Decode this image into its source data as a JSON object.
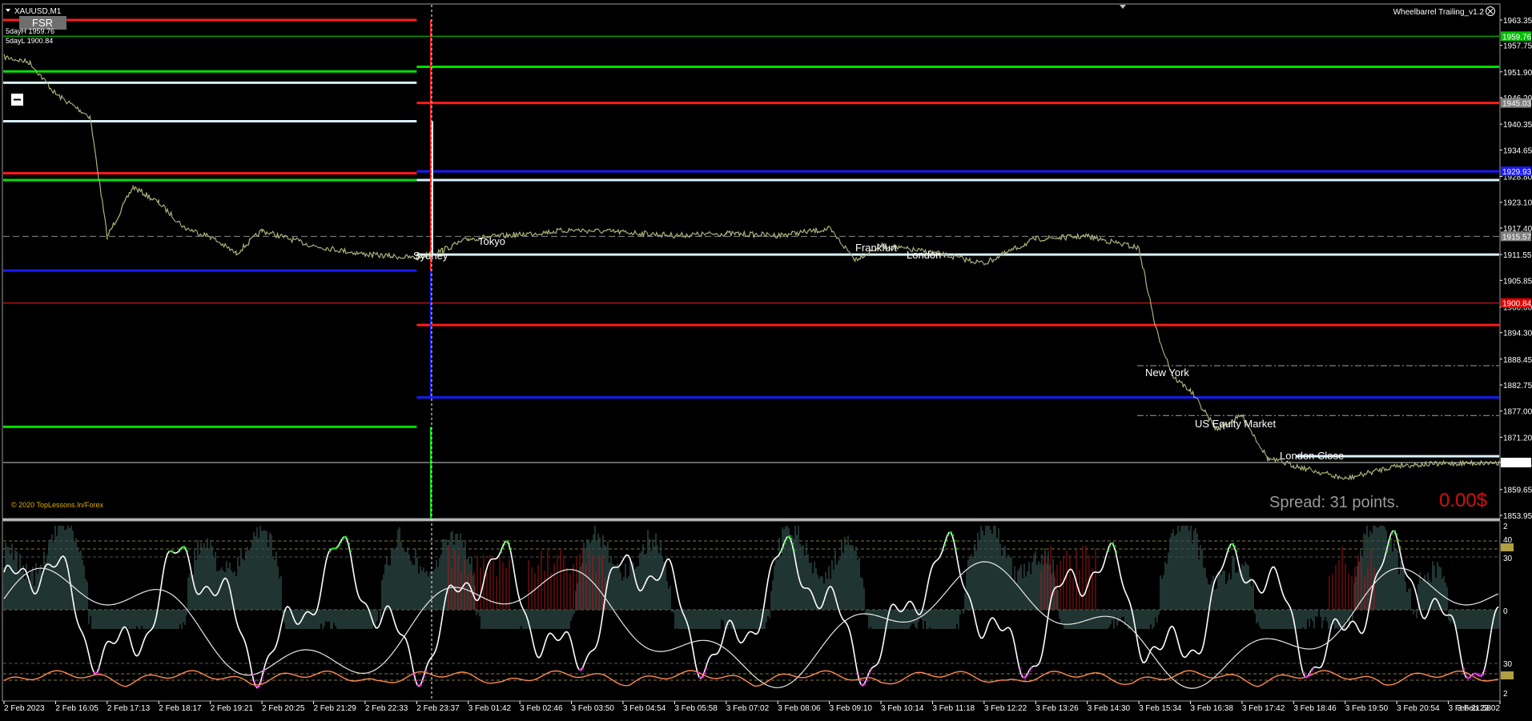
{
  "window": {
    "symbol_label": "XAUUSD,M1",
    "menu_icon": "triangle-down-icon",
    "fsr_button": "FSR",
    "five_day_high": "5dayH 1959.76",
    "five_day_low": "5dayL 1900.84",
    "ea_label": "Wheelbarrel Trailing_v1.2",
    "ea_icon": "smiley-icon",
    "copyright": "© 2020 TopLessons.In/Forex",
    "spread": "Spread: 31 points.",
    "profit": "0.00$"
  },
  "colors": {
    "background": "#000000",
    "price_line": "#c8c86e",
    "red_level": "#ff1a1a",
    "green_level": "#00e000",
    "blue_level": "#1a1aff",
    "lightblue_level": "#d8f0ff",
    "spread_text": "#9a9a9a",
    "profit_text": "#d01010",
    "copyright_text": "#e0b000",
    "price_tag_green": "#00c000",
    "price_tag_red": "#e00000",
    "price_tag_blue": "#1a1aff",
    "price_tag_gray": "#808080"
  },
  "price_axis": {
    "ticks": [
      "1963.35",
      "1957.75",
      "1951.90",
      "1946.20",
      "1940.35",
      "1934.65",
      "1928.80",
      "1923.10",
      "1917.40",
      "1911.55",
      "1905.85",
      "1900.00",
      "1894.30",
      "1888.45",
      "1882.75",
      "1877.00",
      "1871.20",
      "1865.61",
      "1859.65",
      "1853.95"
    ],
    "tags": [
      {
        "text": "1959.76",
        "color": "green"
      },
      {
        "text": "1945.03",
        "color": "gray"
      },
      {
        "text": "1929.93",
        "color": "blue"
      },
      {
        "text": "1915.57",
        "color": "gray"
      },
      {
        "text": "1900.84",
        "color": "red"
      },
      {
        "text": "1865.61",
        "color": "white"
      }
    ]
  },
  "indicator_axis": {
    "ticks": [
      "2",
      "40",
      "30",
      "0",
      "30",
      "40",
      "2"
    ]
  },
  "time_axis": {
    "labels": [
      "2 Feb 2023",
      "2 Feb 16:05",
      "2 Feb 17:13",
      "2 Feb 18:17",
      "2 Feb 19:21",
      "2 Feb 20:25",
      "2 Feb 21:29",
      "2 Feb 22:33",
      "2 Feb 23:37",
      "3 Feb 01:42",
      "3 Feb 02:46",
      "3 Feb 03:50",
      "3 Feb 04:54",
      "3 Feb 05:58",
      "3 Feb 07:02",
      "3 Feb 08:06",
      "3 Feb 09:10",
      "3 Feb 10:14",
      "3 Feb 11:18",
      "3 Feb 12:22",
      "3 Feb 13:26",
      "3 Feb 14:30",
      "3 Feb 15:34",
      "3 Feb 16:38",
      "3 Feb 17:42",
      "3 Feb 18:46",
      "3 Feb 19:50",
      "3 Feb 20:54",
      "3 Feb 21:58",
      "3 Feb 23:02"
    ]
  },
  "sessions": [
    "Sydney",
    "Tokyo",
    "Frankfurt",
    "London",
    "New York",
    "US Equity Market",
    "London Close"
  ],
  "chart_data": {
    "type": "line",
    "symbol": "XAUUSD",
    "timeframe": "M1",
    "ylim": [
      1853.95,
      1966.0
    ],
    "price_path": [
      [
        "2 Feb 2023",
        1955.2
      ],
      [
        "2 Feb 2023",
        1954.0
      ],
      [
        "2 Feb 16:05",
        1947.0
      ],
      [
        "2 Feb 16:05",
        1944.5
      ],
      [
        "2 Feb 16:05",
        1942.0
      ],
      [
        "2 Feb 17:13",
        1915.5
      ],
      [
        "2 Feb 17:13",
        1926.5
      ],
      [
        "2 Feb 18:17",
        1923.0
      ],
      [
        "2 Feb 18:17",
        1917.5
      ],
      [
        "2 Feb 19:21",
        1915.5
      ],
      [
        "2 Feb 19:21",
        1911.8
      ],
      [
        "2 Feb 20:25",
        1916.8
      ],
      [
        "2 Feb 21:29",
        1913.5
      ],
      [
        "2 Feb 22:33",
        1911.6
      ],
      [
        "2 Feb 23:37",
        1910.8
      ],
      [
        "2 Feb 23:37",
        1912.5
      ],
      [
        "3 Feb 01:42",
        1915.0
      ],
      [
        "3 Feb 02:46",
        1916.0
      ],
      [
        "3 Feb 03:50",
        1917.0
      ],
      [
        "3 Feb 04:54",
        1916.5
      ],
      [
        "3 Feb 05:58",
        1915.8
      ],
      [
        "3 Feb 07:02",
        1916.2
      ],
      [
        "3 Feb 08:06",
        1915.8
      ],
      [
        "3 Feb 09:10",
        1917.2
      ],
      [
        "3 Feb 09:10",
        1910.5
      ],
      [
        "3 Feb 10:14",
        1913.5
      ],
      [
        "3 Feb 11:18",
        1912.0
      ],
      [
        "3 Feb 12:22",
        1909.6
      ],
      [
        "3 Feb 13:26",
        1915.0
      ],
      [
        "3 Feb 14:30",
        1915.6
      ],
      [
        "3 Feb 15:34",
        1913.0
      ],
      [
        "3 Feb 15:34",
        1895.0
      ],
      [
        "3 Feb 15:34",
        1884.5
      ],
      [
        "3 Feb 16:38",
        1881.5
      ],
      [
        "3 Feb 16:38",
        1873.0
      ],
      [
        "3 Feb 17:42",
        1876.0
      ],
      [
        "3 Feb 17:42",
        1866.5
      ],
      [
        "3 Feb 18:46",
        1865.0
      ],
      [
        "3 Feb 19:50",
        1862.0
      ],
      [
        "3 Feb 20:54",
        1865.0
      ],
      [
        "3 Feb 21:58",
        1865.4
      ],
      [
        "3 Feb 23:02",
        1865.61
      ]
    ],
    "levels": [
      {
        "price": 1959.76,
        "color": "green",
        "from": "2 Feb 2023",
        "to": "3 Feb 23:02"
      },
      {
        "price": 1963.35,
        "color": "red",
        "from": "2 Feb 2023",
        "to": "2 Feb 23:37"
      },
      {
        "price": 1953.0,
        "color": "green",
        "from": "2 Feb 23:37",
        "to": "3 Feb 23:02"
      },
      {
        "price": 1952.0,
        "color": "green",
        "from": "2 Feb 2023",
        "to": "2 Feb 23:37"
      },
      {
        "price": 1949.5,
        "color": "lightblue",
        "from": "2 Feb 2023",
        "to": "2 Feb 23:37"
      },
      {
        "price": 1945.03,
        "color": "red",
        "from": "2 Feb 23:37",
        "to": "3 Feb 23:02"
      },
      {
        "price": 1941.0,
        "color": "lightblue",
        "from": "2 Feb 2023",
        "to": "2 Feb 23:37"
      },
      {
        "price": 1929.93,
        "color": "blue",
        "from": "2 Feb 23:37",
        "to": "3 Feb 23:02"
      },
      {
        "price": 1929.5,
        "color": "red",
        "from": "2 Feb 2023",
        "to": "2 Feb 23:37"
      },
      {
        "price": 1928.0,
        "color": "green",
        "from": "2 Feb 2023",
        "to": "2 Feb 23:37"
      },
      {
        "price": 1928.0,
        "color": "lightblue",
        "from": "2 Feb 23:37",
        "to": "3 Feb 23:02"
      },
      {
        "price": 1915.57,
        "color": "gray",
        "from": "2 Feb 2023",
        "to": "3 Feb 23:02"
      },
      {
        "price": 1911.55,
        "color": "lightblue",
        "from": "2 Feb 23:37",
        "to": "3 Feb 23:02"
      },
      {
        "price": 1908.0,
        "color": "blue",
        "from": "2 Feb 2023",
        "to": "2 Feb 23:37"
      },
      {
        "price": 1900.84,
        "color": "red",
        "from": "2 Feb 2023",
        "to": "3 Feb 23:02"
      },
      {
        "price": 1896.0,
        "color": "red",
        "from": "2 Feb 23:37",
        "to": "3 Feb 23:02"
      },
      {
        "price": 1880.0,
        "color": "blue",
        "from": "2 Feb 23:37",
        "to": "3 Feb 23:02"
      },
      {
        "price": 1873.5,
        "color": "green",
        "from": "2 Feb 2023",
        "to": "2 Feb 23:37"
      },
      {
        "price": 1865.61,
        "color": "white",
        "from": "2 Feb 2023",
        "to": "3 Feb 23:02"
      }
    ],
    "indicator": {
      "type": "oscillator",
      "ylim": [
        -2,
        2
      ],
      "levels": [
        40,
        30,
        0,
        30,
        40
      ]
    }
  }
}
